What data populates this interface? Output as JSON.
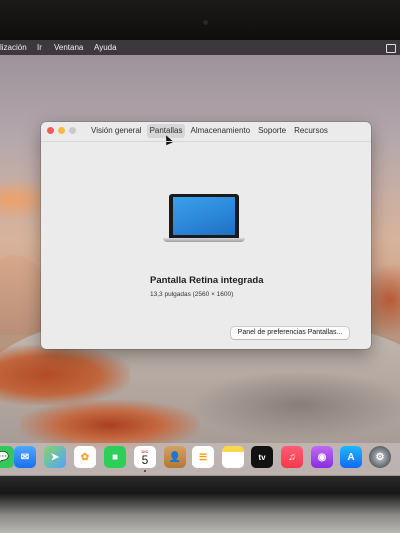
{
  "menubar": {
    "items": [
      "lización",
      "Ir",
      "Ventana",
      "Ayuda"
    ]
  },
  "window": {
    "tabs": [
      {
        "label": "Visión general",
        "active": false
      },
      {
        "label": "Pantallas",
        "active": true
      },
      {
        "label": "Almacenamiento",
        "active": false
      },
      {
        "label": "Soporte",
        "active": false
      },
      {
        "label": "Recursos",
        "active": false
      }
    ],
    "display_name": "Pantalla Retina integrada",
    "display_spec": "13,3 pulgadas (2560 × 1600)",
    "pref_button": "Panel de preferencias Pantallas..."
  },
  "dock": {
    "calendar_month": "DIC",
    "calendar_day": "5",
    "tv_label": "tv",
    "items": [
      "messages",
      "mail",
      "maps",
      "photos",
      "facetime",
      "calendar",
      "contacts",
      "reminders",
      "notes",
      "apple-tv",
      "music",
      "podcasts",
      "app-store",
      "system-preferences"
    ]
  },
  "colors": {
    "accent_red": "#ee5d54",
    "accent_yellow": "#f4bc3f",
    "window_bg": "#ebebec"
  }
}
